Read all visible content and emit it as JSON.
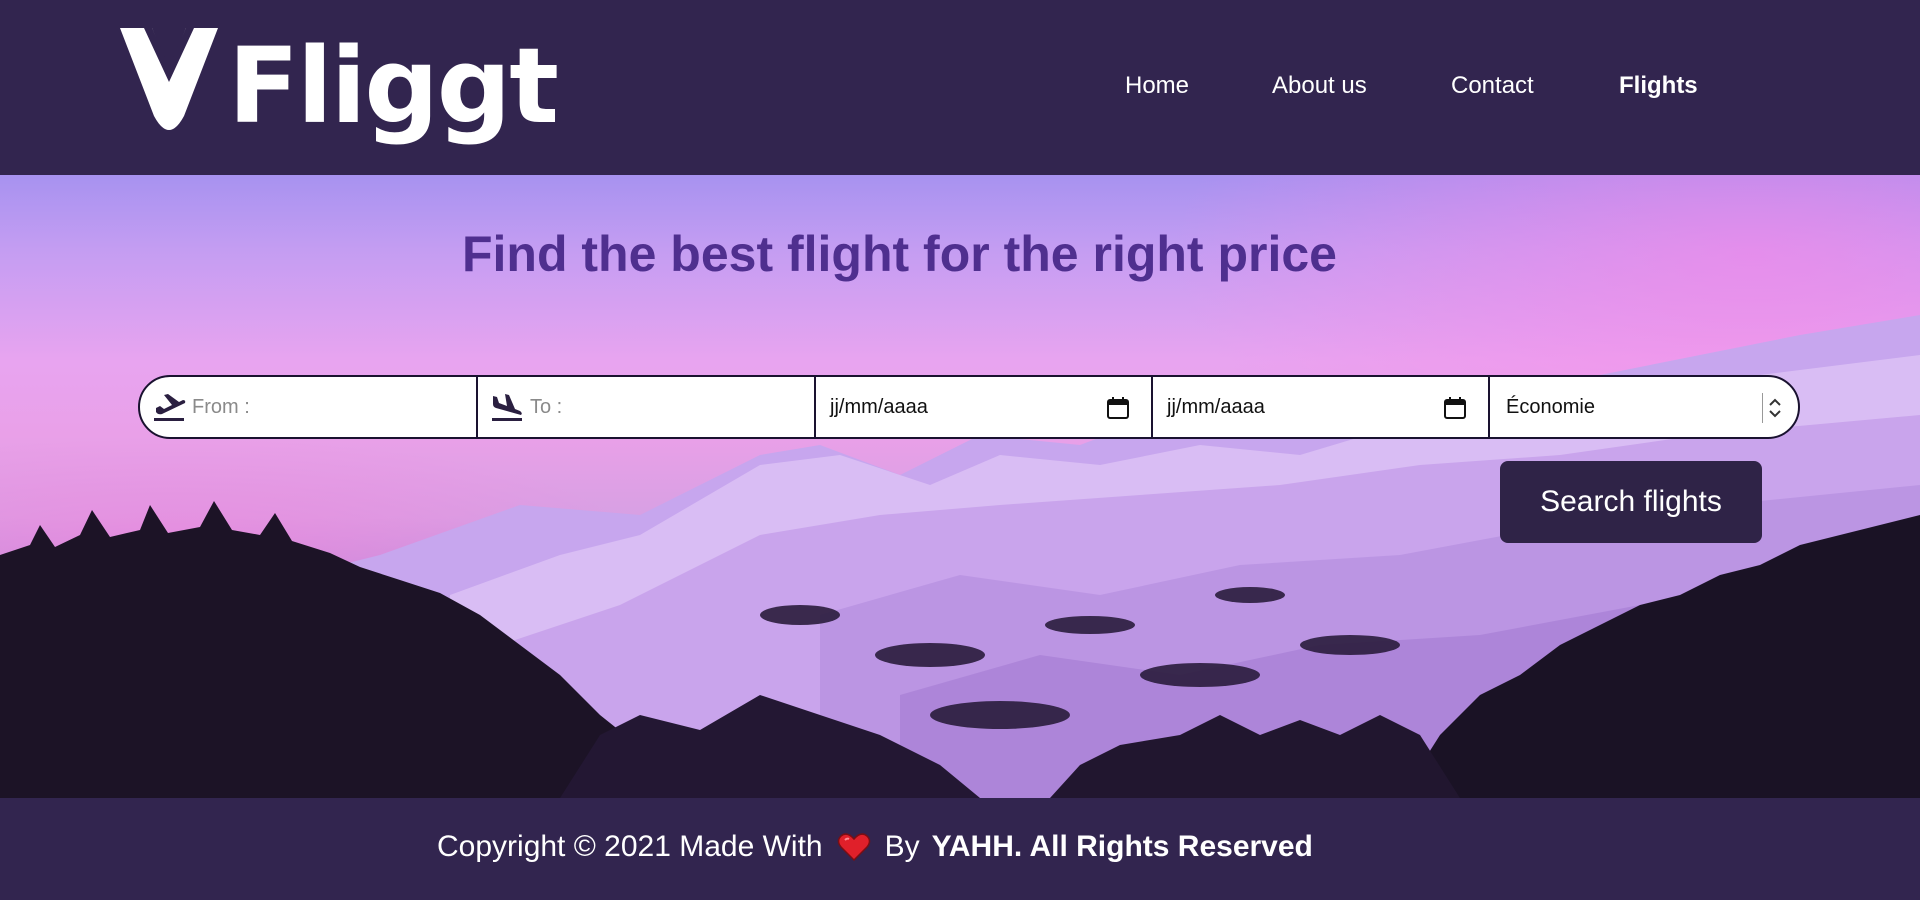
{
  "header": {
    "logo_text": "Fliggt",
    "nav": [
      {
        "label": "Home",
        "active": false
      },
      {
        "label": "About us",
        "active": false
      },
      {
        "label": "Contact",
        "active": false
      },
      {
        "label": "Flights",
        "active": true
      }
    ]
  },
  "hero": {
    "headline": "Find the best flight for the right price"
  },
  "search": {
    "from_placeholder": "From :",
    "to_placeholder": "To :",
    "depart_date": "jj/mm/aaaa",
    "return_date": "jj/mm/aaaa",
    "cabin_class": "Économie",
    "button_label": "Search flights",
    "icons": {
      "from": "plane-departure-icon",
      "to": "plane-arrival-icon",
      "date": "calendar-icon",
      "select": "select-arrows-icon"
    }
  },
  "footer": {
    "text_before_heart": "Copyright © 2021 Made With",
    "text_after_heart": "By",
    "bold_text": "YAHH. All Rights Reserved",
    "heart_icon": "heart-icon"
  },
  "colors": {
    "brand_dark": "#32254f",
    "headline": "#4f2f8f",
    "button": "#2f2347",
    "heart": "#e0202a"
  }
}
